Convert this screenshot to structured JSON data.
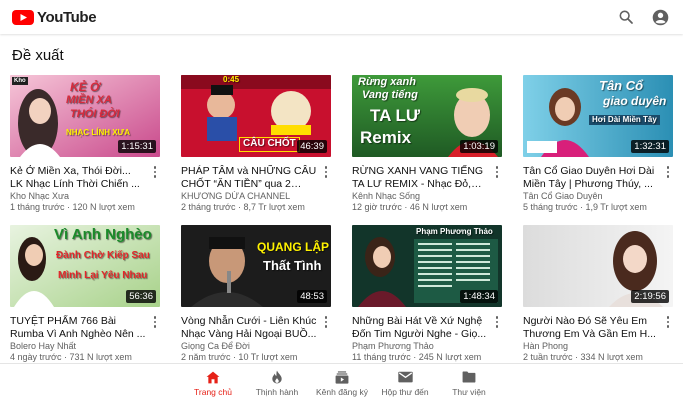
{
  "app": {
    "logo_text": "YouTube",
    "brand_color": "#ff0000"
  },
  "header": {
    "search_icon": "search-icon",
    "account_icon": "account-icon"
  },
  "section": {
    "title": "Đề xuất"
  },
  "videos": [
    {
      "title": "Kẻ Ở Miền Xa, Thói Đời... LK Nhạc Lính Thời Chiến ...",
      "channel": "Kho Nhạc Xưa",
      "stats": "1 tháng trước · 120 N lượt xem",
      "duration": "1:15:31",
      "thumb_text": [
        "KẺ Ở",
        "MIỀN XA",
        "THÓI ĐỜI",
        "NHẠC LÍNH XƯA",
        "Kho"
      ]
    },
    {
      "title": "PHÁP TÂM và NHỮNG CÂU CHỐT “ĂN TIỀN” qua 2 mù...",
      "channel": "KHƯƠNG DỪA CHANNEL",
      "stats": "2 tháng trước · 8,7 Tr lượt xem",
      "duration": "46:39",
      "thumb_text": [
        "CÂU CHỐT",
        "0:45"
      ]
    },
    {
      "title": "RỪNG XANH VANG TIẾNG TA LƯ REMIX - Nhạc Đỏ, N...",
      "channel": "Kênh Nhạc Sống",
      "stats": "12 giờ trước · 46 N lượt xem",
      "duration": "1:03:19",
      "thumb_text": [
        "Rừng xanh",
        "Vang tiếng",
        "TA LƯ",
        "Remix"
      ]
    },
    {
      "title": "Tân Cổ Giao Duyên Hơi Dài Miền Tây | Phương Thúy, ...",
      "channel": "Tân Cổ Giao Duyên",
      "stats": "5 tháng trước · 1,9 Tr lượt xem",
      "duration": "1:32:31",
      "thumb_text": [
        "Tân Cổ",
        "giao duyên",
        "Hơi Dài Miền Tây"
      ]
    },
    {
      "title": "TUYỆT PHẨM 766 Bài Rumba Vì Anh Nghèo Nên ...",
      "channel": "Bolero Hay Nhất",
      "stats": "4 ngày trước · 731 N lượt xem",
      "duration": "56:36",
      "thumb_text": [
        "Vì Anh Nghèo",
        "Đành Chờ Kiếp Sau",
        "Mình Lại Yêu Nhau"
      ]
    },
    {
      "title": "Vòng Nhẫn Cưới - Liên Khúc Nhạc Vàng Hải Ngoại BUỒ...",
      "channel": "Giọng Ca Để Đời",
      "stats": "2 năm trước · 10 Tr lượt xem",
      "duration": "48:53",
      "thumb_text": [
        "QUANG LẬP",
        "Thất Tình"
      ]
    },
    {
      "title": "Những Bài Hát Về Xứ Nghệ Đốn Tim Người Nghe - Giọ...",
      "channel": "Phạm Phương Thảo",
      "stats": "11 tháng trước · 245 N lượt xem",
      "duration": "1:48:34",
      "thumb_text": [
        "Phạm Phương Thảo"
      ]
    },
    {
      "title": "Người Nào Đó Sẽ Yêu Em Thương Em Và Gần Em H...",
      "channel": "Hàn Phong",
      "stats": "2 tuần trước · 334 N lượt xem",
      "duration": "2:19:56",
      "thumb_text": []
    }
  ],
  "nav": [
    {
      "label": "Trang chủ",
      "icon": "home-icon",
      "active": true
    },
    {
      "label": "Thịnh hành",
      "icon": "trending-icon",
      "active": false
    },
    {
      "label": "Kênh đăng ký",
      "icon": "subscriptions-icon",
      "active": false
    },
    {
      "label": "Hộp thư đến",
      "icon": "inbox-icon",
      "active": false
    },
    {
      "label": "Thư viện",
      "icon": "library-icon",
      "active": false
    }
  ],
  "colors": {
    "accent": "#e62117",
    "text_primary": "#0f0f0f",
    "text_secondary": "#606060"
  }
}
